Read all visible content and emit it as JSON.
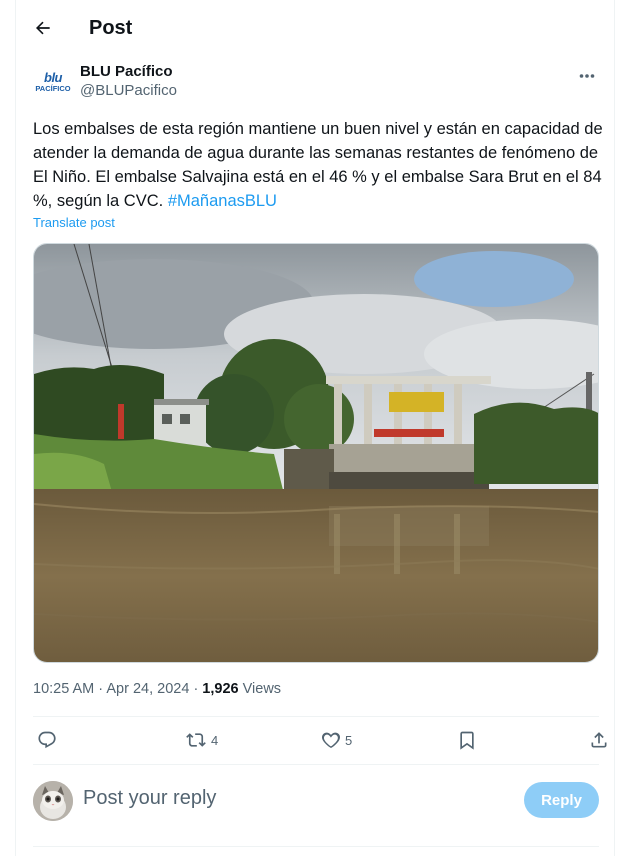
{
  "header": {
    "title": "Post"
  },
  "author": {
    "name": "BLU Pacífico",
    "handle": "@BLUPacifico",
    "logo_top": "blu",
    "logo_bottom": "PACÍFICO"
  },
  "post": {
    "text": "Los embalses de esta región mantiene un buen nivel y están en capacidad de atender la demanda de agua durante las semanas restantes de fenómeno de El Niño. El embalse Salvajina está en el 46 % y el embalse Sara Brut en el 84 %, según la CVC. ",
    "hashtag": "#MañanasBLU",
    "translate_label": "Translate post",
    "image_alt": "River with hydroelectric dam structure and trees under cloudy sky"
  },
  "meta": {
    "time": "10:25 AM",
    "date": "Apr 24, 2024",
    "views": "1,926",
    "views_label": "Views"
  },
  "actions": {
    "reposts": "4",
    "likes": "5"
  },
  "reply": {
    "placeholder": "Post your reply",
    "button_label": "Reply"
  },
  "colors": {
    "accent": "#1d9bf0",
    "reply_button": "#8ecdf7",
    "secondary_text": "#536471"
  }
}
